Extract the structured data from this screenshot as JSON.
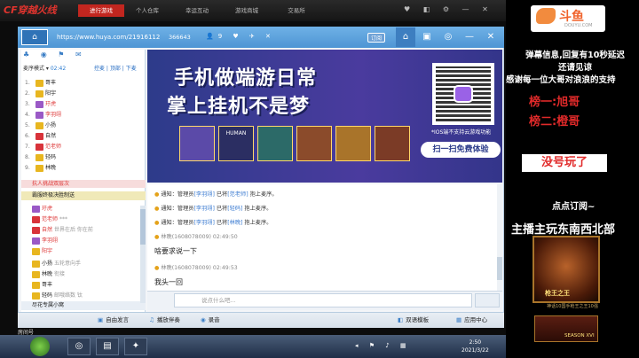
{
  "game_bar": {
    "logo": "CF穿越火线",
    "tabs": [
      "进行游戏",
      "个人仓库",
      "幸运互动",
      "游戏商城",
      "交易所"
    ],
    "icons": "♥ ◧ ⚙ — ✕"
  },
  "client": {
    "url": "https://www.huya.com/21916112",
    "viewers": "366643",
    "title_icons": "👤9 ♥ ✈ ✕",
    "follow": "订阅",
    "tabs_icons": [
      "⌂",
      "▣",
      "◎",
      "—",
      "✕"
    ],
    "left_panel": {
      "mode_label": "麦序模式",
      "time": "02:42",
      "options": [
        "控麦",
        "顶部",
        "下麦"
      ],
      "queue": [
        {
          "n": "1.",
          "name": "哥丰"
        },
        {
          "n": "2.",
          "name": "阳宇"
        },
        {
          "n": "3.",
          "name": "玗虎"
        },
        {
          "n": "4.",
          "name": "李羽翊"
        },
        {
          "n": "5.",
          "name": "小扬"
        },
        {
          "n": "6.",
          "name": "自然"
        },
        {
          "n": "7.",
          "name": "范老师"
        },
        {
          "n": "8.",
          "name": "轻码"
        },
        {
          "n": "9.",
          "name": "林晚"
        }
      ],
      "section1": "抗人挑战双层次",
      "section2": "霸服终极决胜制送",
      "users": [
        {
          "name": "玗虎",
          "note": ""
        },
        {
          "name": "范老师",
          "note": "***"
        },
        {
          "name": "自然",
          "note": "世界在后 你在前"
        },
        {
          "name": "李羽翊",
          "note": ""
        },
        {
          "name": "阳宇",
          "note": ""
        },
        {
          "name": "小扬",
          "note": "五轮意向手"
        },
        {
          "name": "林晚",
          "note": "衔接"
        },
        {
          "name": "哥丰",
          "note": ""
        },
        {
          "name": "轻码",
          "note": "邮哦络数 钛"
        }
      ],
      "section3": "尽花专属小窝"
    },
    "banner": {
      "line1": "手机做端游日常",
      "line2": "掌上挂机不是梦",
      "hero2": "HUMAN",
      "ios_note": "*IOS端不支持云游戏功能",
      "scan_button": "扫一扫免费体验"
    },
    "chat": [
      {
        "type": "notice",
        "prefix": "通知：管理员",
        "user": "[李羽翊]",
        "mid": "已将",
        "target": "[范老师]",
        "tail": "抱上麦序。"
      },
      {
        "type": "notice",
        "prefix": "通知：管理员",
        "user": "[李羽翊]",
        "mid": "已将",
        "target": "[轻码]",
        "tail": "抱上麦序。"
      },
      {
        "type": "notice",
        "prefix": "通知：管理员",
        "user": "[李羽翊]",
        "mid": "已将",
        "target": "[林晚]",
        "tail": "抱上麦序。"
      },
      {
        "type": "meta",
        "text": "林晚(1608078009) 02:49:50"
      },
      {
        "type": "msg",
        "text": "啥要求说一下"
      },
      {
        "type": "meta",
        "text": "林晚(1608078009) 02:49:53"
      },
      {
        "type": "msg",
        "text": "我头一回"
      }
    ],
    "input_placeholder": "说点什么吧...",
    "bottom_bar": [
      "自由发言",
      "播放伴奏",
      "录音",
      "双语模板",
      "应用中心"
    ]
  },
  "watermark": "房间号",
  "taskbar": {
    "time": "2:50",
    "date": "2021/3/22"
  },
  "right_panel": {
    "douyu": "斗鱼",
    "douyu_url": "DOUYU.COM",
    "notice_1": "弹幕信息,回复有10秒延迟",
    "notice_2": "还请见谅",
    "notice_3": "感谢每一位大哥对浪浪的支持",
    "rank_1": "榜一:旭哥",
    "rank_2": "榜二:橙哥",
    "no_gun": "没号玩了",
    "subscribe": "点点订阅~",
    "host": "主播主玩东南西北部",
    "badge_text": "枪王之王",
    "badge_sub": "神话10国手枪王之王10强",
    "season": "SEASON XVI"
  },
  "colors": {
    "accent_red": "#c2261f",
    "title_blue": "#4e95d4",
    "banner": "#3a3b94",
    "douyu_orange": "#f0632c"
  }
}
